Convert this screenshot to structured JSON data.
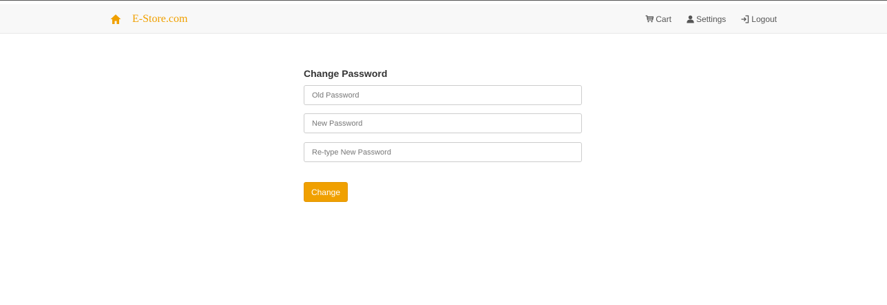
{
  "brand": {
    "name": "E-Store.com",
    "home_icon": "home-icon",
    "color": "#f0a000"
  },
  "nav": {
    "cart": {
      "label": "Cart",
      "icon": "cart-icon"
    },
    "settings": {
      "label": "Settings",
      "icon": "user-icon"
    },
    "logout": {
      "label": "Logout",
      "icon": "login-arrow-icon"
    }
  },
  "form": {
    "title": "Change Password",
    "old_password": {
      "placeholder": "Old Password",
      "value": ""
    },
    "new_password": {
      "placeholder": "New Password",
      "value": ""
    },
    "retype_password": {
      "placeholder": "Re-type New Password",
      "value": ""
    },
    "submit_label": "Change",
    "accent_color": "#f0a000"
  }
}
